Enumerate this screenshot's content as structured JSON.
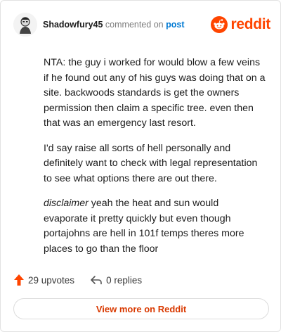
{
  "comment": {
    "author": "Shadowfury45",
    "commented_text": "commented on",
    "post_link": "post",
    "brand": "reddit",
    "paragraphs": [
      "NTA: the guy i worked for would blow a few veins if he found out any of his guys was doing that on a site. backwoods standards is get the owners permission then claim a specific tree. even then that was an emergency last resort.",
      "I'd say raise all sorts of hell personally and definitely want to check with legal representation to see what options there are out there."
    ],
    "disclaimer_word": "disclaimer",
    "disclaimer_rest": " yeah the heat and sun would evaporate it pretty quickly but even though portajohns are hell in 101f temps theres more places to go than the floor",
    "upvotes": "29 upvotes",
    "replies": "0 replies",
    "view_more": "View more on Reddit"
  },
  "colors": {
    "brand": "#ff4500",
    "link": "#0079d3",
    "upvote": "#ff4500",
    "view_more_text": "#d93900"
  },
  "icons": [
    "avatar-icon",
    "reddit-logo-icon",
    "upvote-arrow-icon",
    "reply-arrow-icon"
  ]
}
